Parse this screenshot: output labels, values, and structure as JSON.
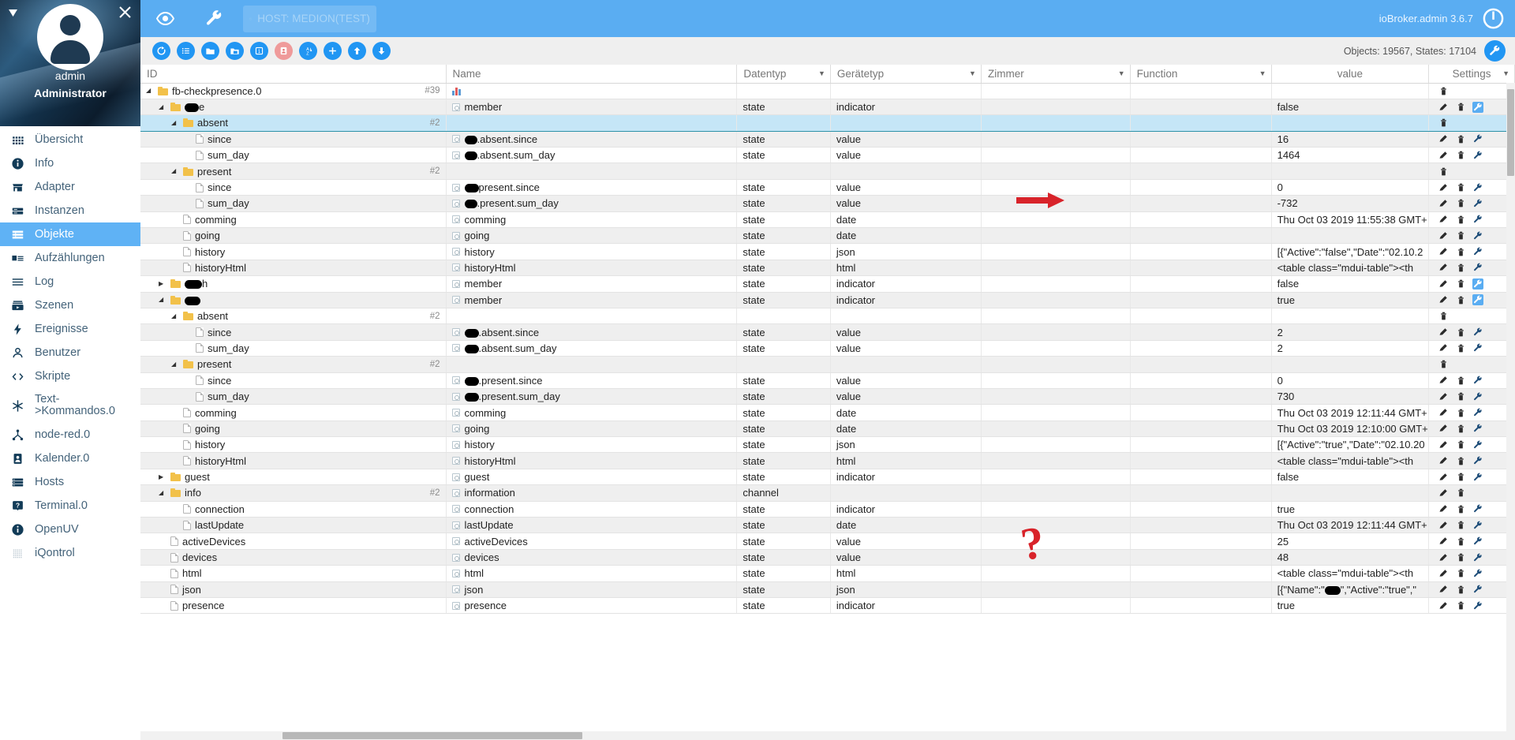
{
  "sidebar": {
    "user": {
      "name": "admin",
      "role": "Administrator"
    },
    "icons": {
      "caret": "caret-down-icon",
      "close": "close-icon",
      "avatar": "avatar-icon"
    },
    "items": [
      {
        "label": "Übersicht",
        "icon": "grid-icon",
        "active": false
      },
      {
        "label": "Info",
        "icon": "info-icon",
        "active": false
      },
      {
        "label": "Adapter",
        "icon": "store-icon",
        "active": false
      },
      {
        "label": "Instanzen",
        "icon": "instances-icon",
        "active": false
      },
      {
        "label": "Objekte",
        "icon": "objects-icon",
        "active": true
      },
      {
        "label": "Aufzählungen",
        "icon": "enums-icon",
        "active": false
      },
      {
        "label": "Log",
        "icon": "log-icon",
        "active": false
      },
      {
        "label": "Szenen",
        "icon": "scenes-icon",
        "active": false
      },
      {
        "label": "Ereignisse",
        "icon": "events-icon",
        "active": false
      },
      {
        "label": "Benutzer",
        "icon": "user-icon",
        "active": false
      },
      {
        "label": "Skripte",
        "icon": "code-icon",
        "active": false
      },
      {
        "label": "Text->Kommandos.0",
        "icon": "snowflake-icon",
        "active": false,
        "two_line": true
      },
      {
        "label": "node-red.0",
        "icon": "nodered-icon",
        "active": false
      },
      {
        "label": "Kalender.0",
        "icon": "calendar-icon",
        "active": false
      },
      {
        "label": "Hosts",
        "icon": "hosts-icon",
        "active": false
      },
      {
        "label": "Terminal.0",
        "icon": "question-icon",
        "active": false
      },
      {
        "label": "OpenUV",
        "icon": "info-icon",
        "active": false
      },
      {
        "label": "iQontrol",
        "icon": "dots-icon",
        "active": false
      }
    ]
  },
  "topbar": {
    "eye_icon": "eye-icon",
    "wrench_icon": "wrench-icon",
    "host_label": "HOST: MEDION(TEST)",
    "host_power_icon": "power-icon",
    "version": "ioBroker.admin 3.6.7",
    "logo_icon": "iobroker-logo-icon"
  },
  "subbar": {
    "buttons": [
      {
        "name": "refresh-button",
        "icon": "refresh-icon",
        "color": "blue"
      },
      {
        "name": "list-button",
        "icon": "list-icon",
        "color": "blue"
      },
      {
        "name": "expand-all-button",
        "icon": "folder-open-icon",
        "color": "blue"
      },
      {
        "name": "collapse-all-button",
        "icon": "folder-icon",
        "color": "blue"
      },
      {
        "name": "one-level-button",
        "icon": "number-one-icon",
        "color": "blue"
      },
      {
        "name": "expert-mode-button",
        "icon": "expert-icon",
        "color": "red"
      },
      {
        "name": "sort-button",
        "icon": "sort-az-icon",
        "color": "blue"
      },
      {
        "name": "add-object-button",
        "icon": "plus-icon",
        "color": "blue"
      },
      {
        "name": "import-button",
        "icon": "upload-icon",
        "color": "blue"
      },
      {
        "name": "export-button",
        "icon": "download-icon",
        "color": "blue"
      }
    ],
    "stats": "Objects: 19567, States: 17104",
    "settings_icon": "wrench-icon"
  },
  "table": {
    "columns": [
      {
        "key": "id",
        "label": "ID",
        "filter": false
      },
      {
        "key": "name",
        "label": "Name",
        "filter": false
      },
      {
        "key": "datentyp",
        "label": "Datentyp",
        "filter": true
      },
      {
        "key": "geraetetyp",
        "label": "Gerätetyp",
        "filter": true
      },
      {
        "key": "zimmer",
        "label": "Zimmer",
        "filter": true
      },
      {
        "key": "function",
        "label": "Function",
        "filter": true
      },
      {
        "key": "value",
        "label": "value",
        "filter": false
      },
      {
        "key": "settings",
        "label": "Settings",
        "filter": true
      }
    ],
    "rows": [
      {
        "indent": 0,
        "type": "folder",
        "id": "fb-checkpresence.0",
        "count": "#39",
        "name": "",
        "name_icon": "chart-icon",
        "datentyp": "",
        "geraetetyp": "",
        "zimmer": "",
        "function": "",
        "value": "",
        "icons": [
          "del"
        ]
      },
      {
        "indent": 1,
        "type": "folder",
        "id": "",
        "redact_id": 18,
        "id_suffix": "e",
        "count": "",
        "name": "member",
        "name_icon": "state",
        "datentyp": "state",
        "geraetetyp": "indicator",
        "zimmer": "",
        "function": "",
        "value": "false",
        "icons": [
          "edit",
          "del",
          "wrench-hl"
        ]
      },
      {
        "indent": 2,
        "type": "folder",
        "id": "absent",
        "count": "#2",
        "name": "",
        "datentyp": "",
        "geraetetyp": "",
        "zimmer": "",
        "function": "",
        "value": "",
        "icons": [
          "del"
        ],
        "selected": true
      },
      {
        "indent": 3,
        "type": "doc",
        "id": "since",
        "count": "",
        "name": ".absent.since",
        "redact_name": 16,
        "name_icon": "state",
        "datentyp": "state",
        "geraetetyp": "value",
        "zimmer": "",
        "function": "",
        "value": "16",
        "icons": [
          "edit",
          "del",
          "wrench"
        ]
      },
      {
        "indent": 3,
        "type": "doc",
        "id": "sum_day",
        "count": "",
        "name": ".absent.sum_day",
        "redact_name": 16,
        "name_icon": "state",
        "datentyp": "state",
        "geraetetyp": "value",
        "zimmer": "",
        "function": "",
        "value": "1464",
        "icons": [
          "edit",
          "del",
          "wrench"
        ]
      },
      {
        "indent": 2,
        "type": "folder",
        "id": "present",
        "count": "#2",
        "name": "",
        "datentyp": "",
        "geraetetyp": "",
        "zimmer": "",
        "function": "",
        "value": "",
        "icons": [
          "del"
        ]
      },
      {
        "indent": 3,
        "type": "doc",
        "id": "since",
        "count": "",
        "name": "present.since",
        "redact_name": 18,
        "name_icon": "state",
        "datentyp": "state",
        "geraetetyp": "value",
        "zimmer": "",
        "function": "",
        "value": "0",
        "icons": [
          "edit",
          "del",
          "wrench"
        ]
      },
      {
        "indent": 3,
        "type": "doc",
        "id": "sum_day",
        "count": "",
        "name": ".present.sum_day",
        "redact_name": 16,
        "name_icon": "state",
        "datentyp": "state",
        "geraetetyp": "value",
        "zimmer": "",
        "function": "",
        "value": "-732",
        "icons": [
          "edit",
          "del",
          "wrench"
        ]
      },
      {
        "indent": 2,
        "type": "doc",
        "id": "comming",
        "count": "",
        "name": "comming",
        "name_icon": "state",
        "datentyp": "state",
        "geraetetyp": "date",
        "zimmer": "",
        "function": "",
        "value": "Thu Oct 03 2019 11:55:38 GMT+",
        "icons": [
          "edit",
          "del",
          "wrench"
        ]
      },
      {
        "indent": 2,
        "type": "doc",
        "id": "going",
        "count": "",
        "name": "going",
        "name_icon": "state",
        "datentyp": "state",
        "geraetetyp": "date",
        "zimmer": "",
        "function": "",
        "value": "",
        "icons": [
          "edit",
          "del",
          "wrench"
        ]
      },
      {
        "indent": 2,
        "type": "doc",
        "id": "history",
        "count": "",
        "name": "history",
        "name_icon": "state",
        "datentyp": "state",
        "geraetetyp": "json",
        "zimmer": "",
        "function": "",
        "value": "[{\"Active\":\"false\",\"Date\":\"02.10.2",
        "icons": [
          "edit",
          "del",
          "wrench"
        ]
      },
      {
        "indent": 2,
        "type": "doc",
        "id": "historyHtml",
        "count": "",
        "name": "historyHtml",
        "name_icon": "state",
        "datentyp": "state",
        "geraetetyp": "html",
        "zimmer": "",
        "function": "",
        "value": "<table class=\"mdui-table\"><th",
        "icons": [
          "edit",
          "del",
          "wrench"
        ]
      },
      {
        "indent": 1,
        "type": "folder",
        "collapsed": true,
        "id": "",
        "redact_id": 22,
        "id_suffix": "h",
        "count": "",
        "name": "member",
        "name_icon": "state",
        "datentyp": "state",
        "geraetetyp": "indicator",
        "zimmer": "",
        "function": "",
        "value": "false",
        "icons": [
          "edit",
          "del",
          "wrench-hl"
        ]
      },
      {
        "indent": 1,
        "type": "folder",
        "id": "",
        "redact_id": 20,
        "id_suffix": "",
        "count": "",
        "name": "member",
        "name_icon": "state",
        "datentyp": "state",
        "geraetetyp": "indicator",
        "zimmer": "",
        "function": "",
        "value": "true",
        "icons": [
          "edit",
          "del",
          "wrench-hl"
        ]
      },
      {
        "indent": 2,
        "type": "folder",
        "id": "absent",
        "count": "#2",
        "name": "",
        "datentyp": "",
        "geraetetyp": "",
        "zimmer": "",
        "function": "",
        "value": "",
        "icons": [
          "del"
        ]
      },
      {
        "indent": 3,
        "type": "doc",
        "id": "since",
        "count": "",
        "name": ".absent.since",
        "redact_name": 18,
        "name_icon": "state",
        "datentyp": "state",
        "geraetetyp": "value",
        "zimmer": "",
        "function": "",
        "value": "2",
        "icons": [
          "edit",
          "del",
          "wrench"
        ]
      },
      {
        "indent": 3,
        "type": "doc",
        "id": "sum_day",
        "count": "",
        "name": ".absent.sum_day",
        "redact_name": 18,
        "name_icon": "state",
        "datentyp": "state",
        "geraetetyp": "value",
        "zimmer": "",
        "function": "",
        "value": "2",
        "icons": [
          "edit",
          "del",
          "wrench"
        ]
      },
      {
        "indent": 2,
        "type": "folder",
        "id": "present",
        "count": "#2",
        "name": "",
        "datentyp": "",
        "geraetetyp": "",
        "zimmer": "",
        "function": "",
        "value": "",
        "icons": [
          "del"
        ]
      },
      {
        "indent": 3,
        "type": "doc",
        "id": "since",
        "count": "",
        "name": ".present.since",
        "redact_name": 18,
        "name_icon": "state",
        "datentyp": "state",
        "geraetetyp": "value",
        "zimmer": "",
        "function": "",
        "value": "0",
        "icons": [
          "edit",
          "del",
          "wrench"
        ]
      },
      {
        "indent": 3,
        "type": "doc",
        "id": "sum_day",
        "count": "",
        "name": ".present.sum_day",
        "redact_name": 18,
        "name_icon": "state",
        "datentyp": "state",
        "geraetetyp": "value",
        "zimmer": "",
        "function": "",
        "value": "730",
        "icons": [
          "edit",
          "del",
          "wrench"
        ]
      },
      {
        "indent": 2,
        "type": "doc",
        "id": "comming",
        "count": "",
        "name": "comming",
        "name_icon": "state",
        "datentyp": "state",
        "geraetetyp": "date",
        "zimmer": "",
        "function": "",
        "value": "Thu Oct 03 2019 12:11:44 GMT+",
        "icons": [
          "edit",
          "del",
          "wrench"
        ]
      },
      {
        "indent": 2,
        "type": "doc",
        "id": "going",
        "count": "",
        "name": "going",
        "name_icon": "state",
        "datentyp": "state",
        "geraetetyp": "date",
        "zimmer": "",
        "function": "",
        "value": "Thu Oct 03 2019 12:10:00 GMT+",
        "icons": [
          "edit",
          "del",
          "wrench"
        ]
      },
      {
        "indent": 2,
        "type": "doc",
        "id": "history",
        "count": "",
        "name": "history",
        "name_icon": "state",
        "datentyp": "state",
        "geraetetyp": "json",
        "zimmer": "",
        "function": "",
        "value": "[{\"Active\":\"true\",\"Date\":\"02.10.20",
        "icons": [
          "edit",
          "del",
          "wrench"
        ]
      },
      {
        "indent": 2,
        "type": "doc",
        "id": "historyHtml",
        "count": "",
        "name": "historyHtml",
        "name_icon": "state",
        "datentyp": "state",
        "geraetetyp": "html",
        "zimmer": "",
        "function": "",
        "value": "<table class=\"mdui-table\"><th",
        "icons": [
          "edit",
          "del",
          "wrench"
        ]
      },
      {
        "indent": 1,
        "type": "folder",
        "collapsed": true,
        "id": "guest",
        "count": "",
        "name": "guest",
        "name_icon": "state",
        "datentyp": "state",
        "geraetetyp": "indicator",
        "zimmer": "",
        "function": "",
        "value": "false",
        "icons": [
          "edit",
          "del",
          "wrench"
        ]
      },
      {
        "indent": 1,
        "type": "folder",
        "id": "info",
        "count": "#2",
        "name": "information",
        "name_icon": "state",
        "datentyp": "channel",
        "geraetetyp": "",
        "zimmer": "",
        "function": "",
        "value": "",
        "icons": [
          "edit",
          "del"
        ]
      },
      {
        "indent": 2,
        "type": "doc",
        "id": "connection",
        "count": "",
        "name": "connection",
        "name_icon": "state",
        "datentyp": "state",
        "geraetetyp": "indicator",
        "zimmer": "",
        "function": "",
        "value": "true",
        "icons": [
          "edit",
          "del",
          "wrench"
        ]
      },
      {
        "indent": 2,
        "type": "doc",
        "id": "lastUpdate",
        "count": "",
        "name": "lastUpdate",
        "name_icon": "state",
        "datentyp": "state",
        "geraetetyp": "date",
        "zimmer": "",
        "function": "",
        "value": "Thu Oct 03 2019 12:11:44 GMT+",
        "icons": [
          "edit",
          "del",
          "wrench"
        ]
      },
      {
        "indent": 1,
        "type": "doc",
        "id": "activeDevices",
        "count": "",
        "name": "activeDevices",
        "name_icon": "state",
        "datentyp": "state",
        "geraetetyp": "value",
        "zimmer": "",
        "function": "",
        "value": "25",
        "icons": [
          "edit",
          "del",
          "wrench"
        ]
      },
      {
        "indent": 1,
        "type": "doc",
        "id": "devices",
        "count": "",
        "name": "devices",
        "name_icon": "state",
        "datentyp": "state",
        "geraetetyp": "value",
        "zimmer": "",
        "function": "",
        "value": "48",
        "icons": [
          "edit",
          "del",
          "wrench"
        ]
      },
      {
        "indent": 1,
        "type": "doc",
        "id": "html",
        "count": "",
        "name": "html",
        "name_icon": "state",
        "datentyp": "state",
        "geraetetyp": "html",
        "zimmer": "",
        "function": "",
        "value": "<table class=\"mdui-table\"><th",
        "icons": [
          "edit",
          "del",
          "wrench"
        ]
      },
      {
        "indent": 1,
        "type": "doc",
        "id": "json",
        "count": "",
        "name": "json",
        "name_icon": "state",
        "datentyp": "state",
        "geraetetyp": "json",
        "zimmer": "",
        "function": "",
        "value": "[{\"Name\":\"██\",\"Active\":\"true\",\"",
        "icons": [
          "edit",
          "del",
          "wrench"
        ]
      },
      {
        "indent": 1,
        "type": "doc",
        "id": "presence",
        "count": "",
        "name": "presence",
        "name_icon": "state",
        "datentyp": "state",
        "geraetetyp": "indicator",
        "zimmer": "",
        "function": "",
        "value": "true",
        "icons": [
          "edit",
          "del",
          "wrench"
        ]
      }
    ]
  },
  "annotations": {
    "arrow": {
      "name": "red-arrow-annotation",
      "points_to": "-732"
    },
    "question": {
      "name": "red-question-mark-annotation",
      "text": "?"
    }
  },
  "colors": {
    "accent": "#5aadf2",
    "button": "#2196f3",
    "expert": "#ef9a9a",
    "selection": "#c5e6f7",
    "folder": "#f2c14a"
  }
}
